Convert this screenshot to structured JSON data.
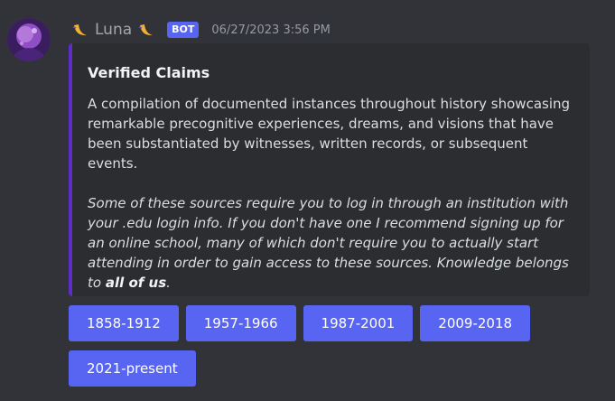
{
  "message": {
    "username": "Luna",
    "bot_badge": "BOT",
    "timestamp": "06/27/2023 3:56 PM",
    "avatar": "avatar-image",
    "name_decoration_icon": "crescent-moon-icon"
  },
  "embed": {
    "accent_color": "#5d2cc9",
    "title": "Verified Claims",
    "description": "A compilation of documented instances throughout history showcasing remarkable precognitive experiences, dreams, and visions that have been substantiated by witnesses, written records, or subsequent events.",
    "note_text": "Some of these sources require you to log in through an institution with your .edu login info. If you don't have one I recommend signing up for an online school, many of which don't require you to actually start attending in order to gain access to these sources. Knowledge belongs to ",
    "note_bold": "all of us",
    "note_end": "."
  },
  "buttons": {
    "color": "#5865f2",
    "row1": [
      "1858-1912",
      "1957-1966",
      "1987-2001",
      "2009-2018"
    ],
    "row2": [
      "2021-present"
    ]
  }
}
